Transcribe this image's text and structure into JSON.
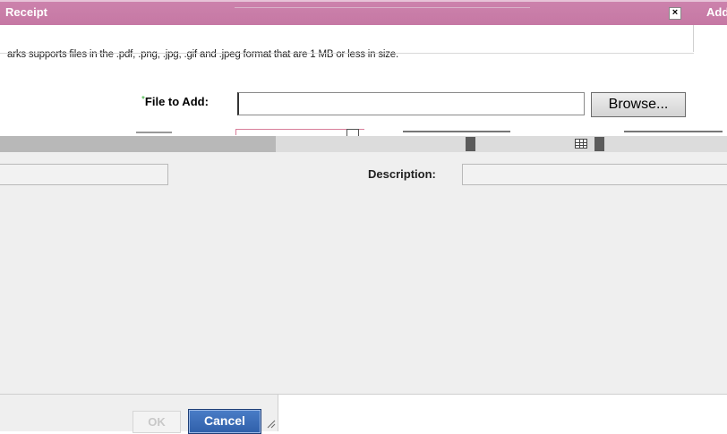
{
  "dialog": {
    "title": "Receipt",
    "title_right": "Add",
    "close_glyph": "×"
  },
  "notice": {
    "text": "arks supports files in the .pdf, .png, .jpg, .gif and .jpeg format that are 1 MB or less in size."
  },
  "form": {
    "file_label": "File to Add:",
    "required_marker": "*",
    "file_value": "",
    "browse_label": "Browse...",
    "description_label": "Description:",
    "description_value": ""
  },
  "footer": {
    "ok_label": "OK",
    "cancel_label": "Cancel"
  },
  "icons": {
    "close": "close-icon",
    "calendar": "calendar-icon",
    "resize": "resize-grip-icon"
  },
  "colors": {
    "titlebar": "#c577a3",
    "cancel_button": "#2f5fa9",
    "required": "#2fae2f"
  }
}
